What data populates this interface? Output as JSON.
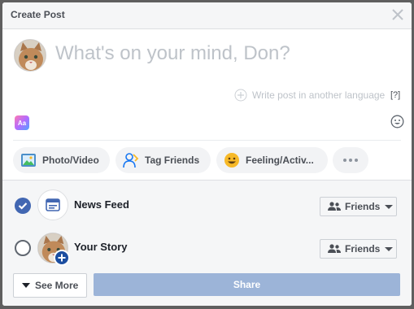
{
  "dialog": {
    "title": "Create Post"
  },
  "composer": {
    "placeholder": "What's on your mind, Don?",
    "translate_link": "Write post in another language",
    "help": "[?]",
    "aa_label": "Aa"
  },
  "actions": [
    {
      "label": "Photo/Video",
      "icon": "photo-video-icon"
    },
    {
      "label": "Tag Friends",
      "icon": "tag-friends-icon"
    },
    {
      "label": "Feeling/Activ...",
      "icon": "feeling-emoji-icon"
    },
    {
      "label": "",
      "icon": "more-dots-icon"
    }
  ],
  "destinations": [
    {
      "label": "News Feed",
      "selected": true,
      "audience": "Friends"
    },
    {
      "label": "Your Story",
      "selected": false,
      "audience": "Friends"
    }
  ],
  "footer": {
    "see_more": "See More",
    "share": "Share"
  },
  "colors": {
    "brand": "#4267b2",
    "share_disabled": "#9cb4d8",
    "header_bg": "#f5f6f7"
  }
}
